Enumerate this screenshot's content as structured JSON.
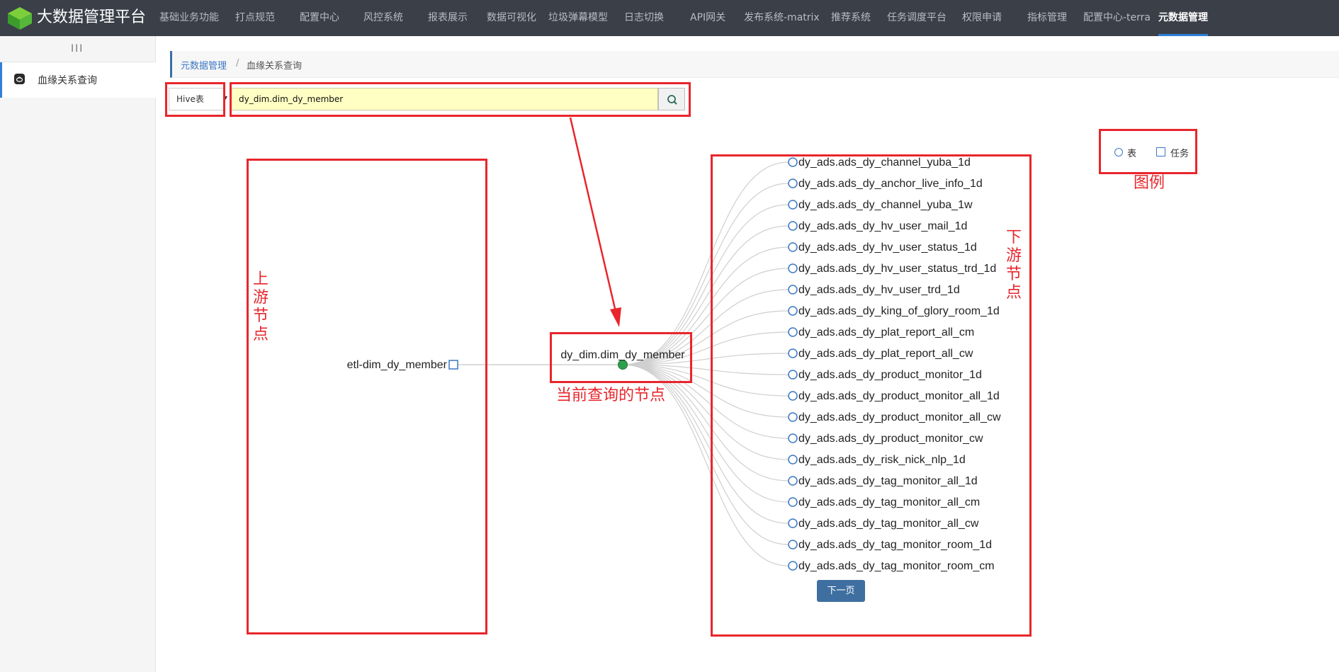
{
  "app": {
    "title": "大数据管理平台",
    "nav": [
      "基础业务功能",
      "打点规范",
      "配置中心",
      "风控系统",
      "报表展示",
      "数据可视化",
      "垃圾弹幕模型",
      "日志切换",
      "API网关",
      "发布系统-matrix",
      "推荐系统",
      "任务调度平台",
      "权限申请",
      "指标管理",
      "配置中心-terra",
      "元数据管理"
    ],
    "active_nav": "元数据管理"
  },
  "sidebar": {
    "toggle": "III",
    "items": [
      {
        "label": "血缘关系查询",
        "icon": "lineage-icon"
      }
    ]
  },
  "breadcrumb": {
    "root": "元数据管理",
    "separator": "/",
    "current": "血缘关系查询"
  },
  "search": {
    "type_value": "Hive表",
    "query_value": "dy_dim.dim_dy_member",
    "button_icon": "search-icon"
  },
  "legend": {
    "table_label": "表",
    "task_label": "任务"
  },
  "graph": {
    "current_node": "dy_dim.dim_dy_member",
    "upstream": [
      {
        "label": "etl-dim_dy_member",
        "kind": "task"
      }
    ],
    "downstream": [
      "dy_ads.ads_dy_channel_yuba_1d",
      "dy_ads.ads_dy_anchor_live_info_1d",
      "dy_ads.ads_dy_channel_yuba_1w",
      "dy_ads.ads_dy_hv_user_mail_1d",
      "dy_ads.ads_dy_hv_user_status_1d",
      "dy_ads.ads_dy_hv_user_status_trd_1d",
      "dy_ads.ads_dy_hv_user_trd_1d",
      "dy_ads.ads_dy_king_of_glory_room_1d",
      "dy_ads.ads_dy_plat_report_all_cm",
      "dy_ads.ads_dy_plat_report_all_cw",
      "dy_ads.ads_dy_product_monitor_1d",
      "dy_ads.ads_dy_product_monitor_all_1d",
      "dy_ads.ads_dy_product_monitor_all_cw",
      "dy_ads.ads_dy_product_monitor_cw",
      "dy_ads.ads_dy_risk_nick_nlp_1d",
      "dy_ads.ads_dy_tag_monitor_all_1d",
      "dy_ads.ads_dy_tag_monitor_all_cm",
      "dy_ads.ads_dy_tag_monitor_all_cw",
      "dy_ads.ads_dy_tag_monitor_room_1d",
      "dy_ads.ads_dy_tag_monitor_room_cm"
    ],
    "next_page_label": "下一页"
  },
  "annotations": {
    "upstream": "上游节点",
    "downstream": "下游节点",
    "current": "当前查询的节点",
    "legend": "图例"
  },
  "colors": {
    "topbar": "#3a3f48",
    "accent": "#2f7fd8",
    "annotation": "#e8262c",
    "node_outline": "#3b77c4",
    "current_node_fill": "#2e9e4f",
    "search_highlight": "#ffffc4"
  }
}
